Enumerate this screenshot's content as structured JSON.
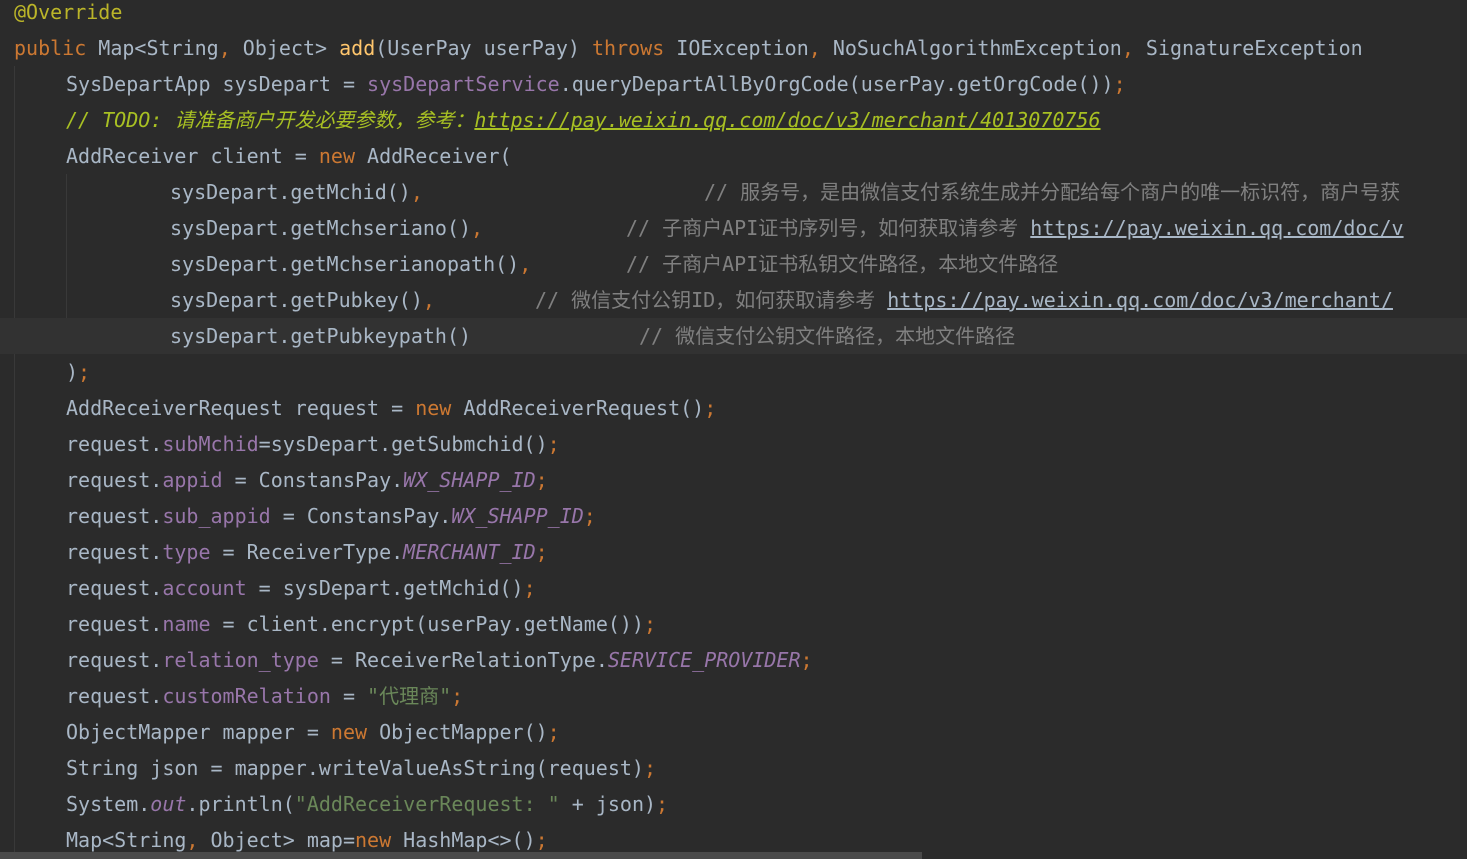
{
  "lines": [
    {
      "annotation": "@Override"
    },
    {
      "kw_public": "public",
      "sig_type": " Map<String",
      "sig_comma1": ",",
      "sig_obj": " Object> ",
      "method": "add",
      "params": "(UserPay userPay) ",
      "kw_throws": "throws",
      "ex1": " IOException",
      "c1": ",",
      "ex2": " NoSuchAlgorithmException",
      "c2": ",",
      "ex3": " SignatureException"
    },
    {
      "pre": "SysDepartApp sysDepart = ",
      "field": "sysDepartService",
      "post": ".queryDepartAllByOrgCode(userPay.getOrgCode())",
      "semi": ";"
    },
    {
      "todo_text": "// TODO: 请准备商户开发必要参数，参考：",
      "todo_link": "https://pay.weixin.qq.com/doc/v3/merchant/4013070756"
    },
    {
      "pre": "AddReceiver client = ",
      "kw_new": "new",
      "post": " AddReceiver("
    },
    {
      "code": "sysDepart.getMchid()",
      "comma": ",",
      "comment": "// 服务号，是由微信支付系统生成并分配给每个商户的唯一标识符，商户号获"
    },
    {
      "code": "sysDepart.getMchseriano()",
      "comma": ",",
      "comment": "// 子商户API证书序列号，如何获取请参考 ",
      "link": "https://pay.weixin.qq.com/doc/v"
    },
    {
      "code": "sysDepart.getMchserianopath()",
      "comma": ",",
      "comment": "// 子商户API证书私钥文件路径，本地文件路径"
    },
    {
      "code": "sysDepart.getPubkey()",
      "comma": ",",
      "comment": "// 微信支付公钥ID，如何获取请参考 ",
      "link": "https://pay.weixin.qq.com/doc/v3/merchant/"
    },
    {
      "code": "sysDepart.getPubkeypath()",
      "comment": "// 微信支付公钥文件路径，本地文件路径"
    },
    {
      "close": ")",
      "semi": ";"
    },
    {
      "pre": "AddReceiverRequest request = ",
      "kw_new": "new",
      "post": " AddReceiverRequest()",
      "semi": ";"
    },
    {
      "obj": "request.",
      "field": "subMchid",
      "post": "=sysDepart.getSubmchid()",
      "semi": ";"
    },
    {
      "obj": "request.",
      "field": "appid",
      "mid": " = ConstansPay.",
      "static": "WX_SHAPP_ID",
      "semi": ";"
    },
    {
      "obj": "request.",
      "field": "sub_appid",
      "mid": " = ConstansPay.",
      "static": "WX_SHAPP_ID",
      "semi": ";"
    },
    {
      "obj": "request.",
      "field": "type",
      "mid": " = ReceiverType.",
      "static": "MERCHANT_ID",
      "semi": ";"
    },
    {
      "obj": "request.",
      "field": "account",
      "post": " = sysDepart.getMchid()",
      "semi": ";"
    },
    {
      "obj": "request.",
      "field": "name",
      "post": " = client.encrypt(userPay.getName())",
      "semi": ";"
    },
    {
      "obj": "request.",
      "field": "relation_type",
      "mid": " = ReceiverRelationType.",
      "static": "SERVICE_PROVIDER",
      "semi": ";"
    },
    {
      "obj": "request.",
      "field": "customRelation",
      "mid": " = ",
      "str": "\"代理商\"",
      "semi": ";"
    },
    {
      "pre": "ObjectMapper mapper = ",
      "kw_new": "new",
      "post": " ObjectMapper()",
      "semi": ";"
    },
    {
      "pre": "String json = mapper.writeValueAsString(request)",
      "semi": ";"
    },
    {
      "pre": "System.",
      "static": "out",
      "mid": ".println(",
      "str": "\"AddReceiverRequest: \"",
      "post": " + json)",
      "semi": ";"
    },
    {
      "pre": "Map<String",
      "comma": ",",
      "mid": " Object> map=",
      "kw_new": "new",
      "post": " HashMap<>()",
      "semi": ";"
    }
  ],
  "colors": {
    "background": "#2b2b2b",
    "current_line": "#323232",
    "keyword": "#cc7832",
    "method_decl": "#ffc66d",
    "field": "#9876aa",
    "string": "#6a8759",
    "comment": "#808080",
    "todo": "#a8c023",
    "annotation": "#bbb529",
    "text": "#a9b7c6"
  }
}
